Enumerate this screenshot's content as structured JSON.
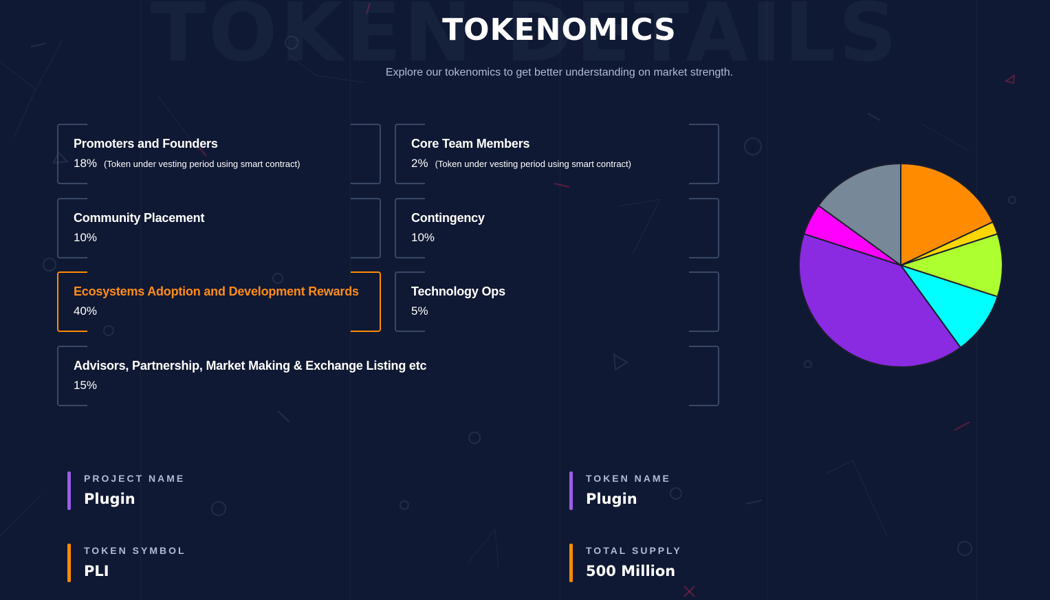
{
  "header": {
    "watermark": "TOKEN DETAILS",
    "title": "TOKENOMICS",
    "subtitle": "Explore our tokenomics to get better understanding on market strength."
  },
  "allocations": [
    {
      "name": "Promoters and Founders",
      "value": "18%",
      "note": "(Token under vesting period using smart contract)",
      "active": false
    },
    {
      "name": "Core Team Members",
      "value": "2%",
      "note": "(Token under vesting period using smart contract)",
      "active": false
    },
    {
      "name": "Community Placement",
      "value": "10%",
      "note": "",
      "active": false
    },
    {
      "name": "Contingency",
      "value": "10%",
      "note": "",
      "active": false
    },
    {
      "name": "Ecosystems Adoption and Development Rewards",
      "value": "40%",
      "note": "",
      "active": true
    },
    {
      "name": "Technology Ops",
      "value": "5%",
      "note": "",
      "active": false
    },
    {
      "name": "Advisors, Partnership, Market Making & Exchange Listing etc",
      "value": "15%",
      "note": "",
      "active": false
    }
  ],
  "token_info": {
    "project_name": {
      "label": "PROJECT NAME",
      "value": "Plugin"
    },
    "token_name": {
      "label": "TOKEN NAME",
      "value": "Plugin"
    },
    "token_symbol": {
      "label": "TOKEN SYMBOL",
      "value": "PLI"
    },
    "total_supply": {
      "label": "TOTAL SUPPLY",
      "value": "500 Million"
    }
  },
  "colors": {
    "background": "#101933",
    "accent": "#ff8c00",
    "purple_bar": "#9b5de5",
    "orange_bar": "#ff8c00",
    "card_border": "#3a4868"
  },
  "chart_data": {
    "type": "pie",
    "categories": [
      "Promoters and Founders",
      "Core Team Members",
      "Community Placement",
      "Contingency",
      "Ecosystems Adoption and Development Rewards",
      "Technology Ops",
      "Advisors, Partnership, Market Making & Exchange Listing etc"
    ],
    "values": [
      18,
      2,
      10,
      10,
      40,
      5,
      15
    ],
    "colors": [
      "#ff8c00",
      "#ffd700",
      "#adff2f",
      "#00ffff",
      "#8a2be2",
      "#ff00ff",
      "#778899"
    ],
    "start": "12 o'clock",
    "direction": "clockwise"
  }
}
